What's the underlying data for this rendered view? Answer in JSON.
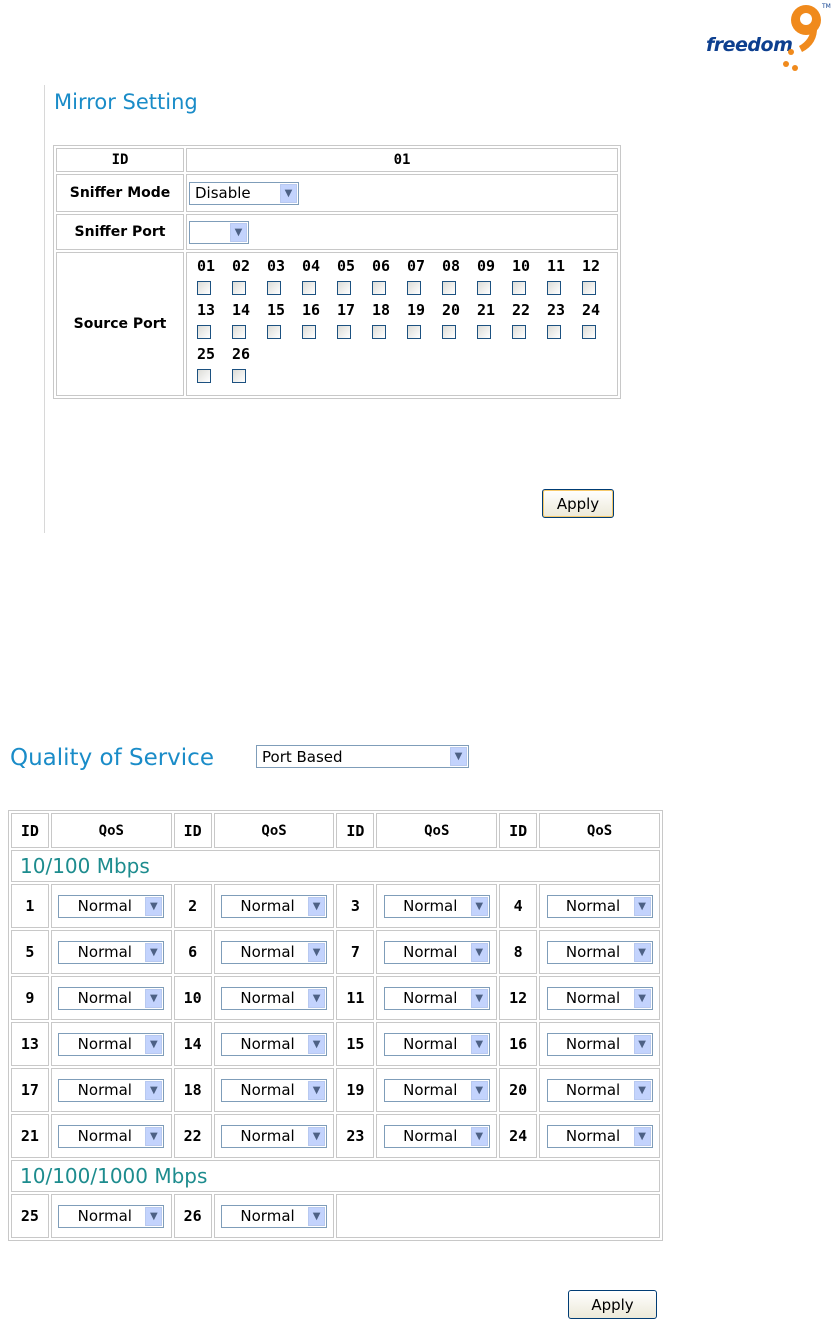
{
  "logo": {
    "text": "freedom",
    "tm": "TM"
  },
  "mirror": {
    "title": "Mirror Setting",
    "id_label": "ID",
    "id_value": "01",
    "sniffer_mode_label": "Sniffer Mode",
    "sniffer_mode_value": "Disable",
    "sniffer_port_label": "Sniffer Port",
    "sniffer_port_value": "",
    "source_port_label": "Source Port",
    "source_port_rows": [
      [
        "01",
        "02",
        "03",
        "04",
        "05",
        "06",
        "07",
        "08",
        "09",
        "10",
        "11",
        "12"
      ],
      [
        "13",
        "14",
        "15",
        "16",
        "17",
        "18",
        "19",
        "20",
        "21",
        "22",
        "23",
        "24"
      ],
      [
        "25",
        "26"
      ]
    ],
    "apply_label": "Apply"
  },
  "qos": {
    "title": "Quality of Service",
    "mode_value": "Port Based",
    "header_id": "ID",
    "header_qos": "QoS",
    "section_fast": "10/100 Mbps",
    "section_gig": "10/100/1000 Mbps",
    "default_value": "Normal",
    "ports": [
      {
        "id": "1",
        "value": "Normal"
      },
      {
        "id": "2",
        "value": "Normal"
      },
      {
        "id": "3",
        "value": "Normal"
      },
      {
        "id": "4",
        "value": "Normal"
      },
      {
        "id": "5",
        "value": "Normal"
      },
      {
        "id": "6",
        "value": "Normal"
      },
      {
        "id": "7",
        "value": "Normal"
      },
      {
        "id": "8",
        "value": "Normal"
      },
      {
        "id": "9",
        "value": "Normal"
      },
      {
        "id": "10",
        "value": "Normal"
      },
      {
        "id": "11",
        "value": "Normal"
      },
      {
        "id": "12",
        "value": "Normal"
      },
      {
        "id": "13",
        "value": "Normal"
      },
      {
        "id": "14",
        "value": "Normal"
      },
      {
        "id": "15",
        "value": "Normal"
      },
      {
        "id": "16",
        "value": "Normal"
      },
      {
        "id": "17",
        "value": "Normal"
      },
      {
        "id": "18",
        "value": "Normal"
      },
      {
        "id": "19",
        "value": "Normal"
      },
      {
        "id": "20",
        "value": "Normal"
      },
      {
        "id": "21",
        "value": "Normal"
      },
      {
        "id": "22",
        "value": "Normal"
      },
      {
        "id": "23",
        "value": "Normal"
      },
      {
        "id": "24",
        "value": "Normal"
      }
    ],
    "gig_ports": [
      {
        "id": "25",
        "value": "Normal"
      },
      {
        "id": "26",
        "value": "Normal"
      }
    ],
    "apply_label": "Apply"
  },
  "colors": {
    "title": "#1a8cc8",
    "section": "#1d8c8e",
    "logo_text": "#0d3f8f",
    "logo_accent": "#f08a1c"
  }
}
